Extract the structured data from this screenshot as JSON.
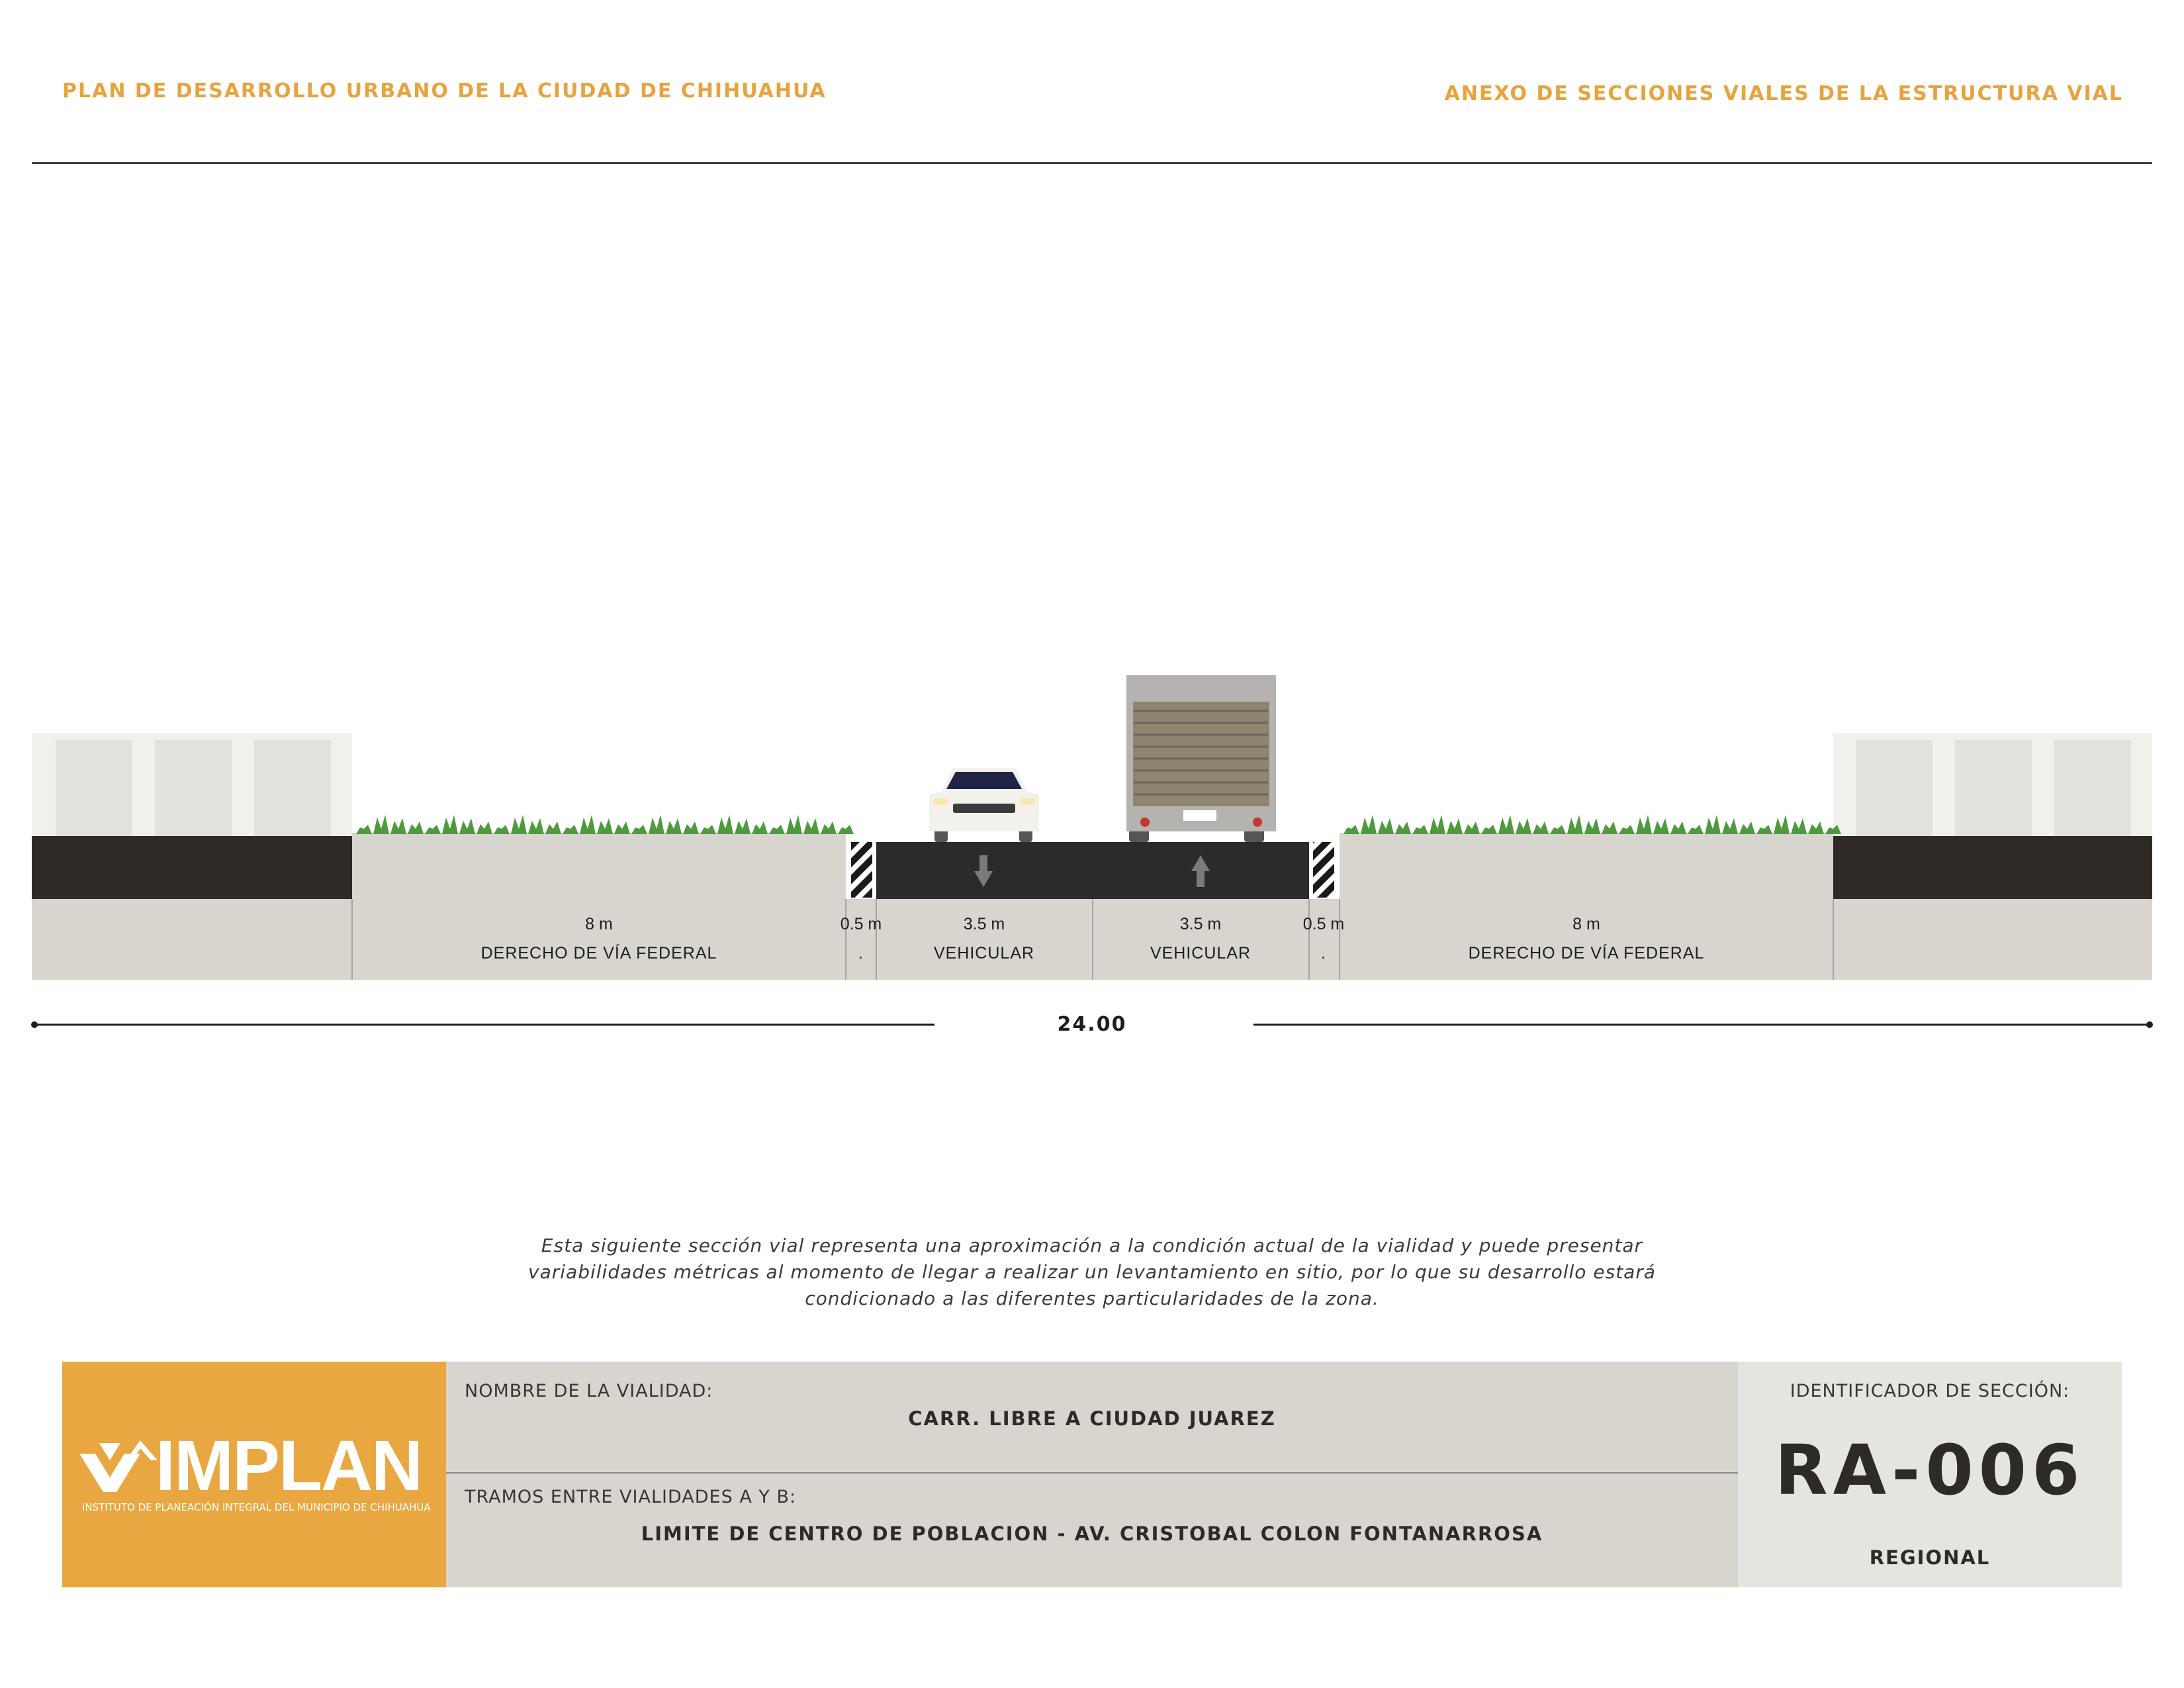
{
  "header": {
    "left_title": "PLAN DE DESARROLLO URBANO DE LA CIUDAD DE CHIHUAHUA",
    "right_title": "ANEXO DE SECCIONES VIALES DE LA ESTRUCTURA VIAL"
  },
  "section": {
    "segments": [
      {
        "width": "8 m",
        "name": "DERECHO DE VÍA FEDERAL"
      },
      {
        "width": "0.5 m",
        "name": "."
      },
      {
        "width": "3.5 m",
        "name": "VEHICULAR",
        "direction": "down"
      },
      {
        "width": "3.5 m",
        "name": "VEHICULAR",
        "direction": "up"
      },
      {
        "width": "0.5 m",
        "name": "."
      },
      {
        "width": "8 m",
        "name": "DERECHO DE VÍA FEDERAL"
      }
    ],
    "total_width": "24.00"
  },
  "note": "Esta siguiente sección vial representa una aproximación a la condición actual de la vialidad y puede presentar variabilidades métricas al momento de llegar a realizar un levantamiento en sitio, por lo que su desarrollo estará condicionado a las diferentes particularidades de la zona.",
  "title_block": {
    "logo_text": "IMPLAN",
    "logo_subtitle": "INSTITUTO DE PLANEACIÓN INTEGRAL DEL MUNICIPIO DE CHIHUAHUA",
    "road_name_label": "NOMBRE DE LA VIALIDAD:",
    "road_name": "CARR. LIBRE A CIUDAD JUAREZ",
    "stretch_label": "TRAMOS ENTRE VIALIDADES A Y B:",
    "stretch": "LIMITE DE CENTRO DE POBLACION - AV. CRISTOBAL COLON FONTANARROSA",
    "id_label": "IDENTIFICADOR DE SECCIÓN:",
    "id": "RA-006",
    "classification": "REGIONAL"
  },
  "colors": {
    "accent": "#e9a741",
    "asphalt": "#2b2b2b",
    "ground": "#d8d4ce",
    "vegetation": "#4f9a3f"
  }
}
